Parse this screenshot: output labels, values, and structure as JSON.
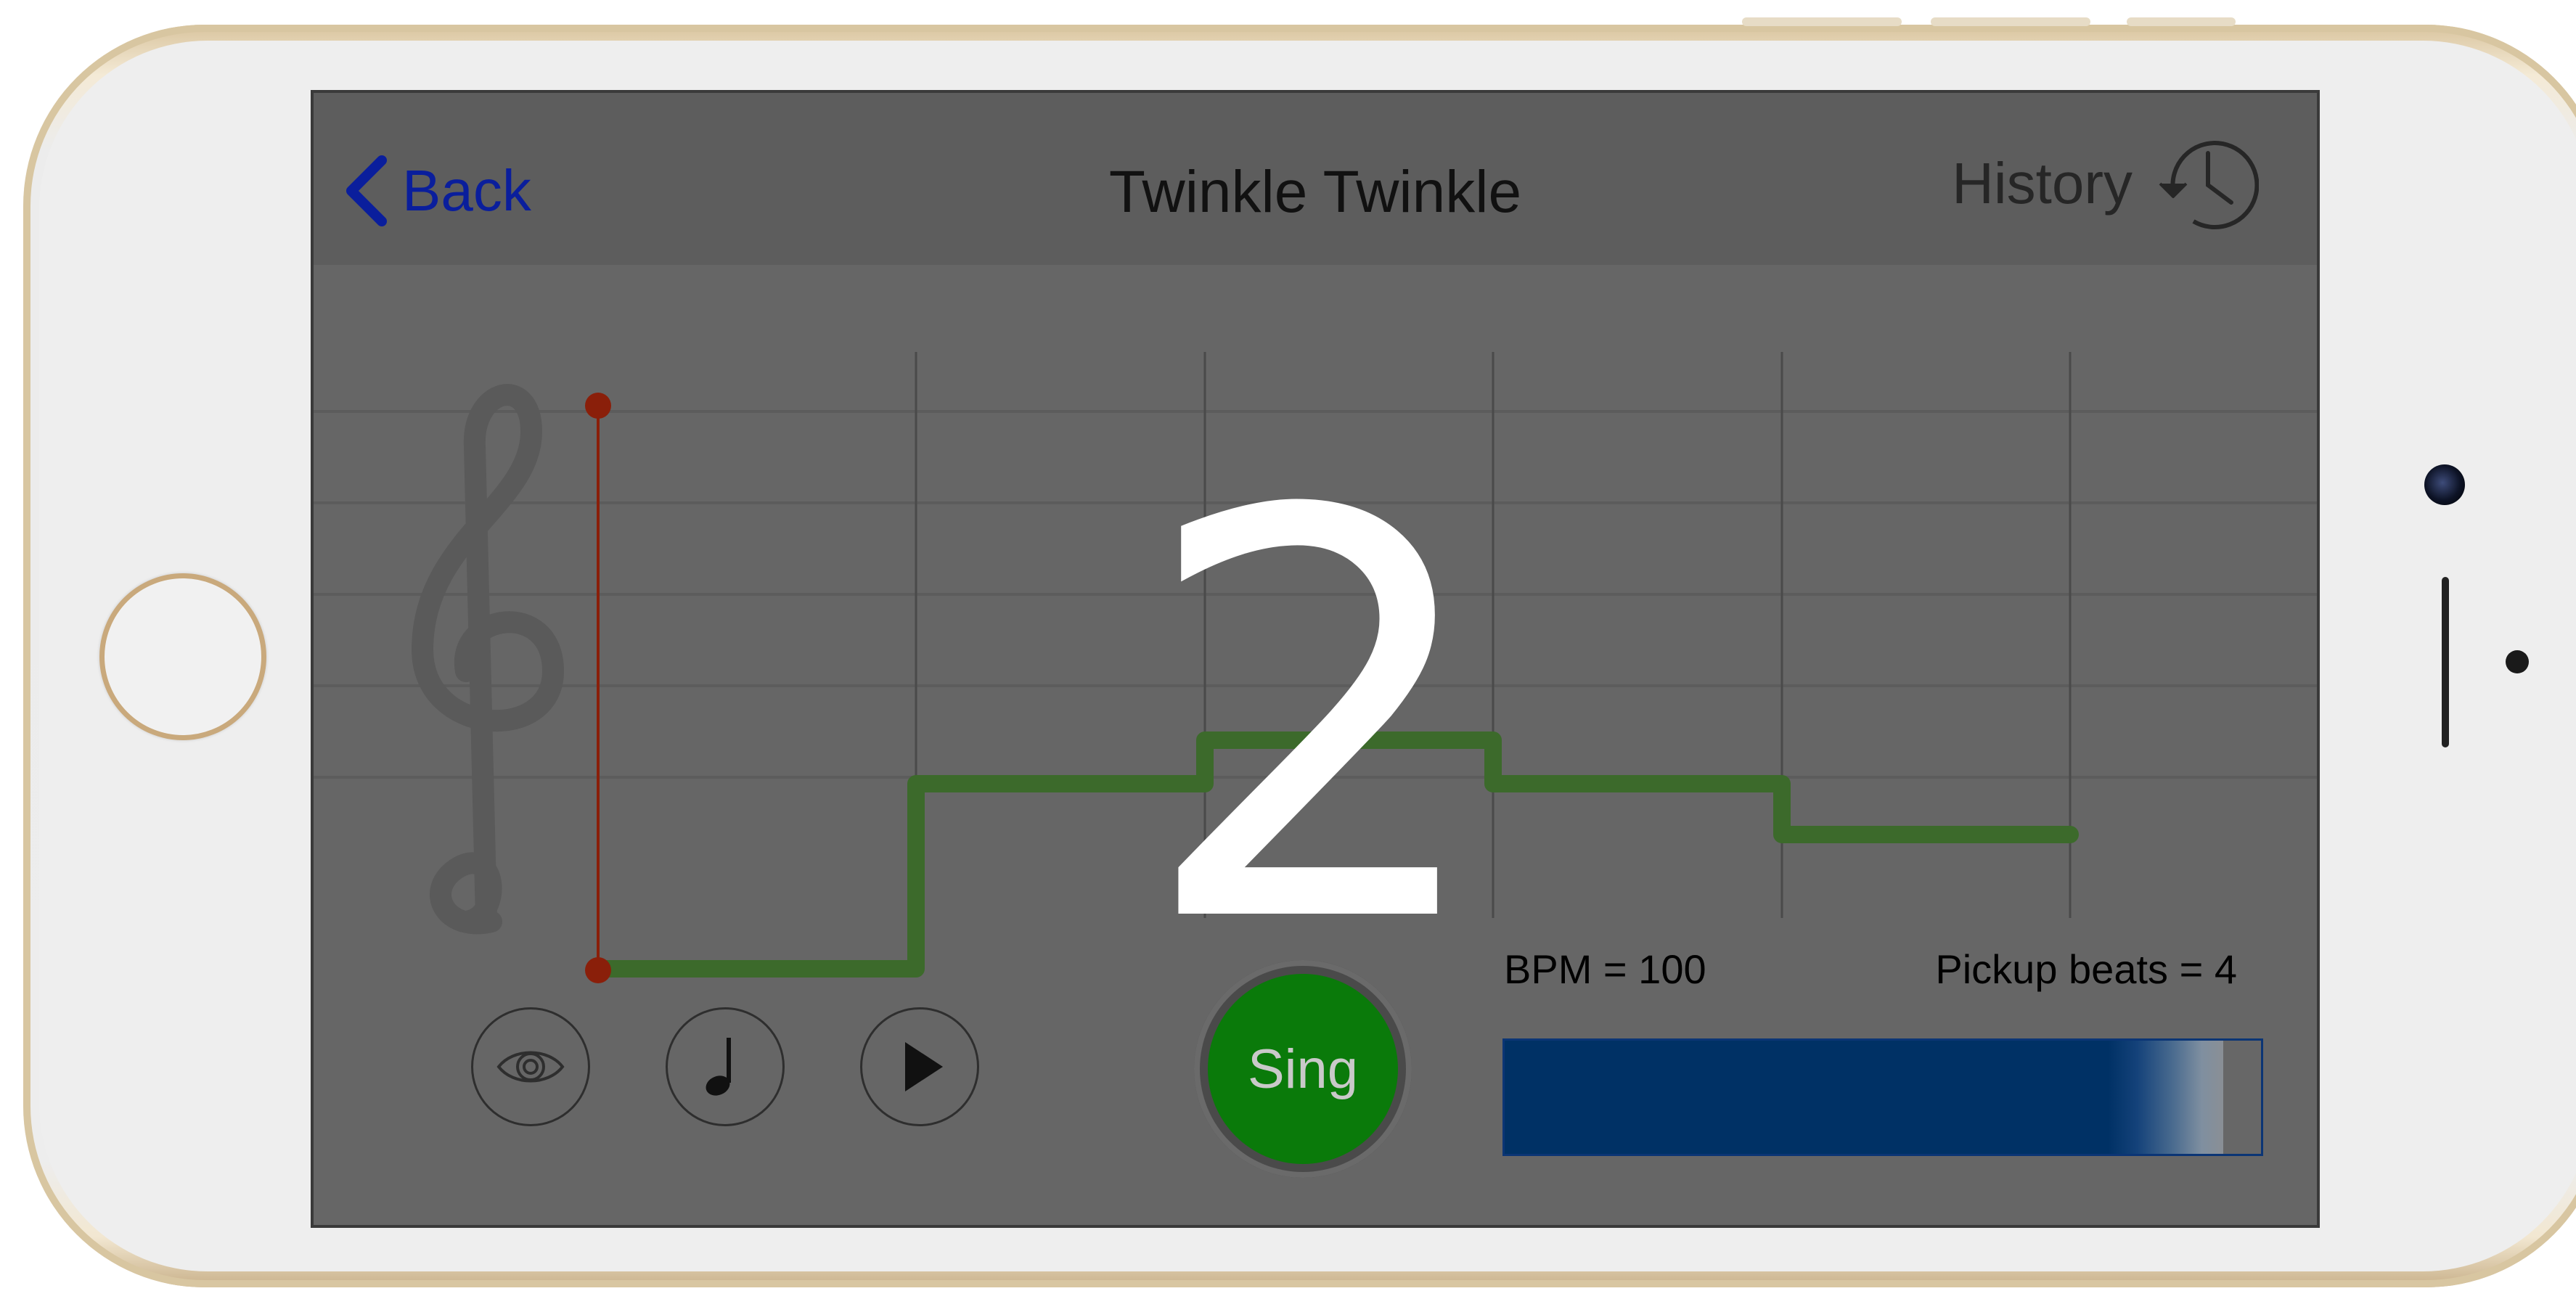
{
  "nav": {
    "back_label": "Back",
    "title": "Twinkle Twinkle",
    "history_label": "History"
  },
  "countdown": "2",
  "controls": {
    "view_icon": "eye-icon",
    "note_icon": "quarter-note-icon",
    "play_icon": "play-icon",
    "sing_label": "Sing"
  },
  "status": {
    "bpm": "BPM = 100",
    "pickup": "Pickup beats = 4",
    "progress": 0.95
  },
  "colors": {
    "accent_link": "#0a1e9c",
    "melody": "#3c6a2b",
    "cursor": "#8a1f0a",
    "sing": "#0a7a0a",
    "progress": "#003165"
  }
}
